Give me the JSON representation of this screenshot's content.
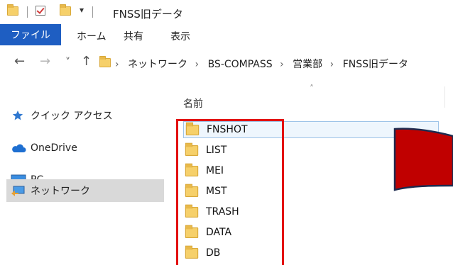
{
  "titlebar": {
    "dropdown": "▾",
    "title": "FNSS旧データ"
  },
  "ribbon": {
    "tabs": [
      "ファイル",
      "ホーム",
      "共有",
      "表示"
    ]
  },
  "address": {
    "back": "←",
    "forward": "→",
    "recent": "˅",
    "up": "↑",
    "crumbs": [
      "ネットワーク",
      "BS-COMPASS",
      "営業部",
      "FNSS旧データ"
    ],
    "separator": "›"
  },
  "sidebar": {
    "items": [
      {
        "label": "クイック アクセス",
        "icon": "star-icon"
      },
      {
        "label": "OneDrive",
        "icon": "cloud-icon"
      },
      {
        "label": "PC",
        "icon": "monitor-icon"
      },
      {
        "label": "ネットワーク",
        "icon": "network-icon"
      }
    ]
  },
  "content": {
    "column_name": "名前",
    "rows": [
      "FNSHOT",
      "LIST",
      "MEI",
      "MST",
      "TRASH",
      "DATA",
      "DB"
    ]
  },
  "colors": {
    "file_tab": "#1e5ec2",
    "highlight": "#e31111",
    "arrow_fill": "#c00000"
  }
}
